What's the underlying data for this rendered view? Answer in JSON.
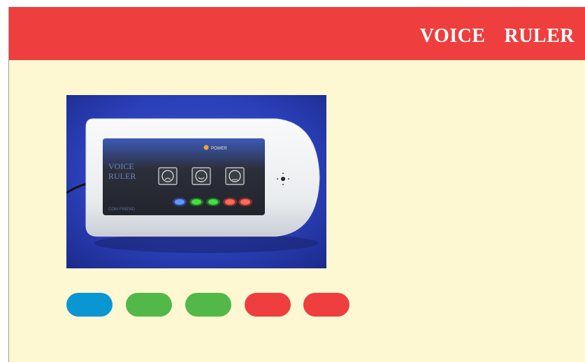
{
  "header": {
    "title": "VOICE  RULER"
  },
  "colors": {
    "header_bg": "#ee3e3e",
    "panel_bg": "#fef8d2",
    "title_text": "#ffffff"
  },
  "product_photo": {
    "device_brand_text": "VOICE\nRULER",
    "power_label": "POWER",
    "footer_text": "COM FRIEND",
    "faces": [
      "sad-face-icon",
      "smile-face-icon",
      "angry-face-icon"
    ]
  },
  "level_indicators": [
    {
      "name": "level-quiet",
      "color": "#0a96d2"
    },
    {
      "name": "level-good-1",
      "color": "#52b848"
    },
    {
      "name": "level-good-2",
      "color": "#52b848"
    },
    {
      "name": "level-loud-1",
      "color": "#ee3e3e"
    },
    {
      "name": "level-loud-2",
      "color": "#ee3e3e"
    }
  ]
}
